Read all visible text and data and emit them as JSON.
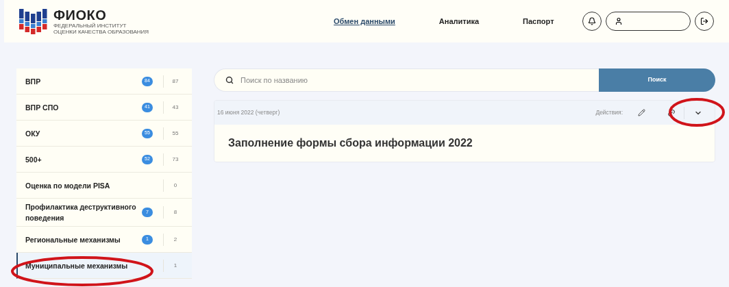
{
  "header": {
    "logo": {
      "title": "ФИОКО",
      "subtitle_lines": [
        "ФЕДЕРАЛЬНЫЙ ИНСТИТУТ",
        "ОЦЕНКИ КАЧЕСТВА ОБРАЗОВАНИЯ"
      ]
    },
    "nav": [
      {
        "label": "Обмен данными",
        "selected": true
      },
      {
        "label": "Аналитика",
        "selected": false
      },
      {
        "label": "Паспорт",
        "selected": false
      }
    ]
  },
  "sidebar": {
    "items": [
      {
        "label": "ВПР",
        "badge": "84",
        "count": "87",
        "selected": false
      },
      {
        "label": "ВПР СПО",
        "badge": "41",
        "count": "43",
        "selected": false
      },
      {
        "label": "ОКУ",
        "badge": "55",
        "count": "55",
        "selected": false
      },
      {
        "label": "500+",
        "badge": "52",
        "count": "73",
        "selected": false
      },
      {
        "label": "Оценка по модели PISA",
        "count": "0",
        "selected": false
      },
      {
        "label": "Профилактика деструктивного поведения",
        "badge": "7",
        "count": "8",
        "selected": false
      },
      {
        "label": "Региональные механизмы",
        "badge": "1",
        "count": "2",
        "selected": false
      },
      {
        "label": "Муниципальные механизмы",
        "count": "1",
        "selected": true
      }
    ]
  },
  "search": {
    "placeholder": "Поиск по названию",
    "button": "Поиск"
  },
  "card": {
    "date": "16 июня 2022 (четверг)",
    "actions_label": "Действия:",
    "title": "Заполнение формы сбора информации 2022"
  }
}
